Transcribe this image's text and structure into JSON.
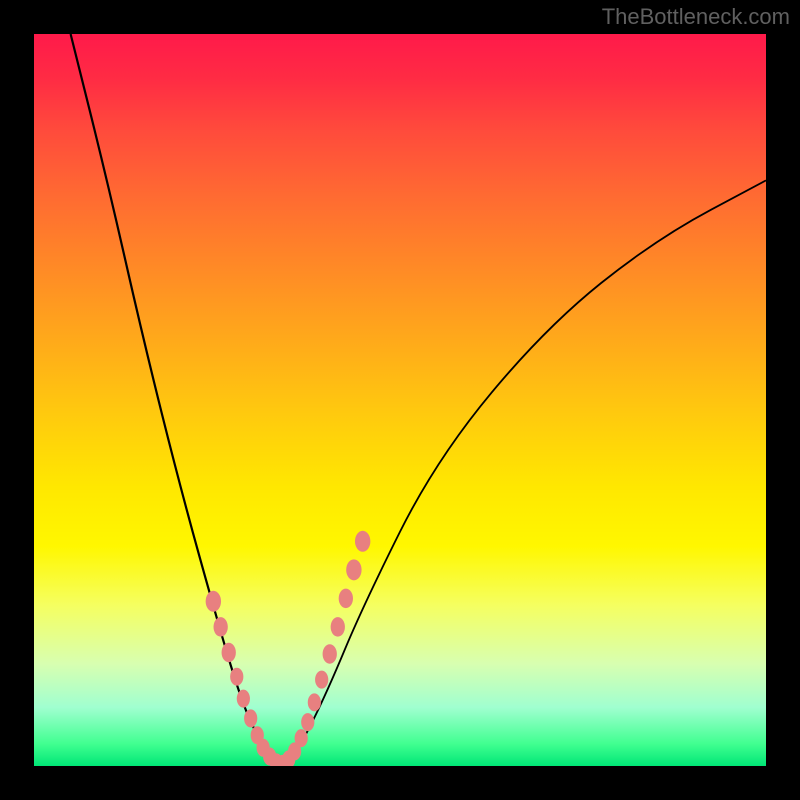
{
  "watermark": "TheBottleneck.com",
  "colors": {
    "background": "#000000",
    "curve": "#000000",
    "marker": "#e88080"
  },
  "chart_data": {
    "type": "line",
    "title": "",
    "xlabel": "",
    "ylabel": "",
    "xlim": [
      0,
      100
    ],
    "ylim": [
      0,
      100
    ],
    "curve_left": {
      "description": "Steep descending curve from upper-left to valley",
      "x": [
        5,
        10,
        15,
        20,
        25,
        28,
        30,
        32,
        34
      ],
      "y": [
        100,
        80,
        58,
        38,
        20,
        10,
        5,
        2,
        0
      ]
    },
    "curve_right": {
      "description": "Ascending curve from valley toward upper-right",
      "x": [
        34,
        36,
        40,
        45,
        55,
        70,
        85,
        100
      ],
      "y": [
        0,
        2,
        10,
        22,
        42,
        60,
        72,
        80
      ]
    },
    "series": [
      {
        "name": "markers-left",
        "x": [
          24.5,
          25.5,
          26.6,
          27.7,
          28.6,
          29.6,
          30.5,
          31.3,
          32.2,
          33.1
        ],
        "y": [
          22.5,
          19.0,
          15.5,
          12.2,
          9.2,
          6.5,
          4.2,
          2.5,
          1.3,
          0.5
        ],
        "marker_size": [
          14,
          13,
          13,
          12,
          12,
          12,
          12,
          12,
          12,
          12
        ]
      },
      {
        "name": "markers-right",
        "x": [
          34.0,
          34.8,
          35.6,
          36.5,
          37.4,
          38.3,
          39.3,
          40.4,
          41.5,
          42.6,
          43.7,
          44.9
        ],
        "y": [
          0.3,
          0.9,
          2.0,
          3.8,
          6.0,
          8.7,
          11.8,
          15.3,
          19.0,
          22.9,
          26.8,
          30.7
        ],
        "marker_size": [
          12,
          12,
          12,
          12,
          12,
          12,
          12,
          13,
          13,
          13,
          14,
          14
        ]
      }
    ]
  }
}
